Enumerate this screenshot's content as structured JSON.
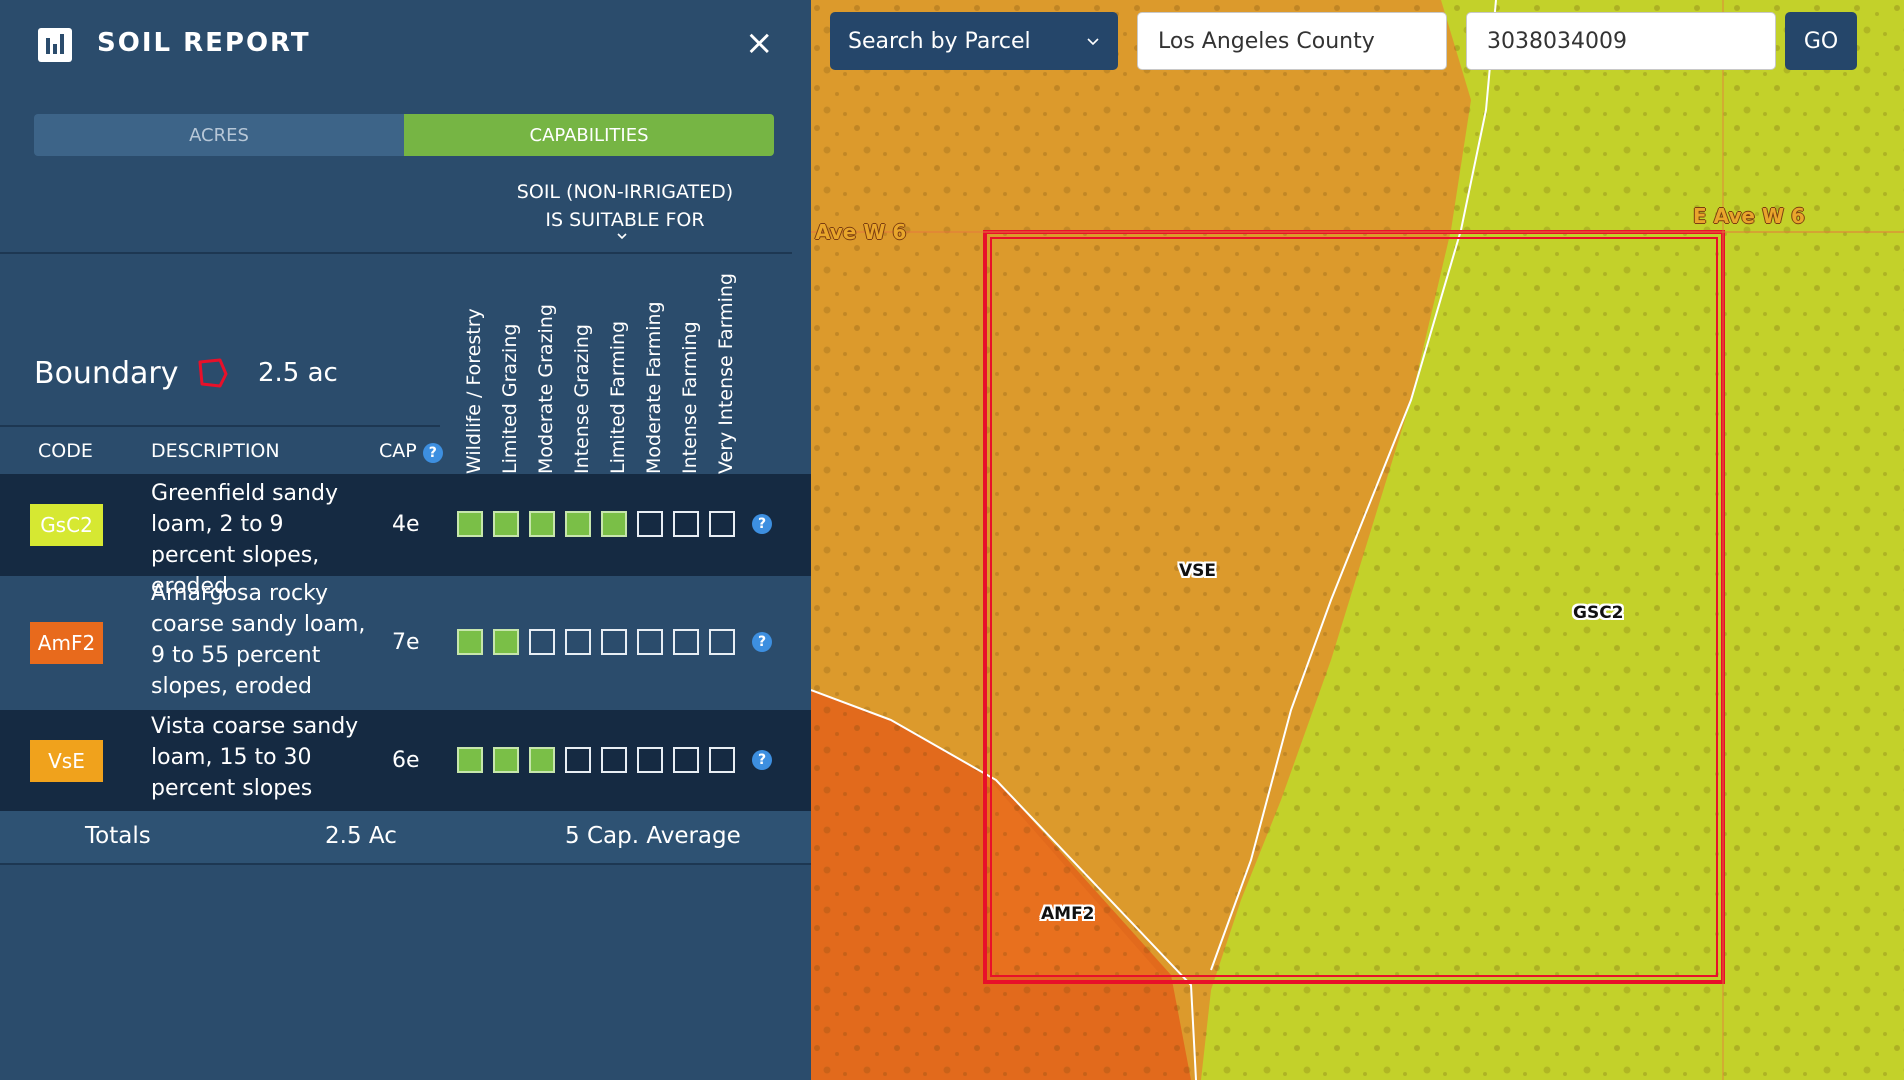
{
  "panel": {
    "title": "SOIL REPORT",
    "close_glyph": "×",
    "tabs": [
      {
        "label": "ACRES",
        "active": false
      },
      {
        "label": "CAPABILITIES",
        "active": true
      }
    ],
    "suitability_heading_line1": "SOIL (NON-IRRIGATED)",
    "suitability_heading_line2": "IS SUITABLE FOR",
    "boundary": {
      "label": "Boundary",
      "acres": "2.5 ac",
      "icon": "polygon-icon"
    },
    "columns": {
      "code": "CODE",
      "description": "DESCRIPTION",
      "cap": "CAP",
      "help_glyph": "?"
    },
    "uses": [
      "Wildlife / Forestry",
      "Limited Grazing",
      "Moderate Grazing",
      "Intense Grazing",
      "Limited Farming",
      "Moderate Farming",
      "Intense Farming",
      "Very Intense Farming"
    ],
    "rows": [
      {
        "code": "GsC2",
        "color": "#d6e832",
        "description": "Greenfield sandy loam, 2 to 9 percent slopes, eroded",
        "cap": "4e",
        "suitable": [
          true,
          true,
          true,
          true,
          true,
          false,
          false,
          false
        ]
      },
      {
        "code": "AmF2",
        "color": "#e86a1c",
        "description": "Amargosa rocky coarse sandy loam, 9 to 55 percent slopes, eroded",
        "cap": "7e",
        "suitable": [
          true,
          true,
          false,
          false,
          false,
          false,
          false,
          false
        ]
      },
      {
        "code": "VsE",
        "color": "#f0a21c",
        "description": "Vista coarse sandy loam, 15 to 30 percent slopes",
        "cap": "6e",
        "suitable": [
          true,
          true,
          true,
          false,
          false,
          false,
          false,
          false
        ]
      }
    ],
    "totals": {
      "label": "Totals",
      "acres": "2.5 Ac",
      "average": "5 Cap. Average"
    }
  },
  "map": {
    "search_mode": "Search by Parcel",
    "county": "Los Angeles County",
    "parcel": "3038034009",
    "go_label": "GO",
    "zone_labels": {
      "vse": "VSE",
      "gsc2": "GSC2",
      "amf2": "AMF2"
    },
    "streets": {
      "left": "Ave W 6",
      "right": "E Ave W 6"
    },
    "colors": {
      "gsc2": "#d6e832",
      "vse": "#f0a21c",
      "amf2": "#e86a1c",
      "boundary": "#e8102a"
    }
  }
}
